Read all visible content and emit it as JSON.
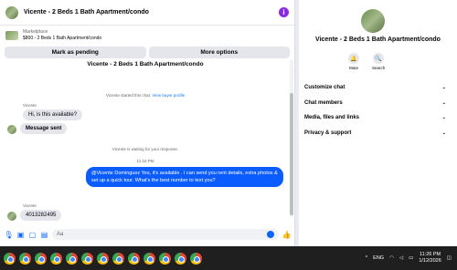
{
  "chat": {
    "title": "Vicente - 2 Beds 1 Bath Apartment/condo",
    "listing_source": "Marketplace",
    "listing_name": "$800 - 2 Beds 1 Bath Apartment/condo",
    "mark_pending_label": "Mark as pending",
    "more_options_label": "More options",
    "thread_title": "Vicente - 2 Beds 1 Bath Apartment/condo",
    "started_text": "Vicente started this chat.",
    "view_profile_link": "View buyer profile",
    "sender1": "Vicente",
    "msg1": "Hi, is this available?",
    "msg2": "Message sent",
    "waiting_text": "Vicente is waiting for your response.",
    "time": "11:16 PM",
    "outgoing": "@Vicente Dominguez Yes, it's available .  I can send you rent details, extra photos & set up a quick tour. What's the best number to text you?",
    "sender2": "Vicente",
    "msg3": "4013282495",
    "input_placeholder": "Aa"
  },
  "info": {
    "title": "Vicente - 2 Beds 1 Bath Apartment/condo",
    "mute_label": "Mute",
    "search_label": "Search",
    "sections": [
      "Customize chat",
      "Chat members",
      "Media, files and links",
      "Privacy & support"
    ]
  },
  "taskbar": {
    "language": "ENG",
    "time": "11:26 PM",
    "date": "1/12/2026"
  },
  "colors": {
    "accent": "#0866ff",
    "outgoing_bubble": "#0a5cff",
    "info_icon": "#8a2be2"
  }
}
